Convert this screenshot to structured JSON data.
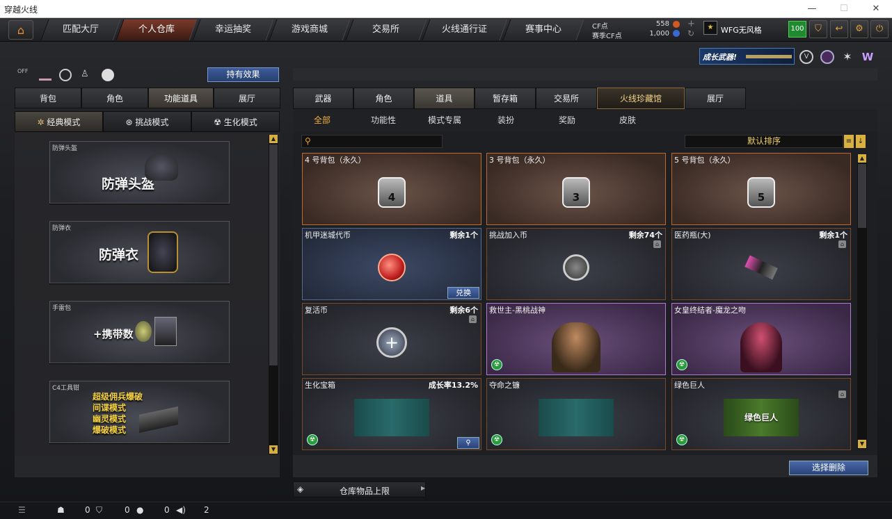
{
  "window": {
    "title": "穿越火线",
    "min": "—",
    "max": "☐",
    "close": "✕"
  },
  "topnav": {
    "tabs": [
      "匹配大厅",
      "个人仓库",
      "幸运抽奖",
      "游戏商城",
      "交易所",
      "火线通行证",
      "赛事中心"
    ],
    "cf_label": "CF点",
    "cf_value": "558",
    "scf_label": "赛季CF点",
    "scf_value": "1,000",
    "user": "WFG无风格",
    "level": "100"
  },
  "banner": {
    "text": "成长武器!"
  },
  "left": {
    "effects_btn": "持有效果",
    "tabs": [
      "背包",
      "角色",
      "功能道具",
      "展厅"
    ],
    "modes": [
      "经典模式",
      "挑战模式",
      "生化模式"
    ],
    "cards": [
      {
        "cap": "防弹头盔",
        "big": "防弹头盔"
      },
      {
        "cap": "防弹衣",
        "big": "防弹衣"
      },
      {
        "cap": "手雷包",
        "big": "+携带数"
      },
      {
        "cap": "C4工具钳",
        "lines": [
          "超级佣兵爆破",
          "间谍模式",
          "幽灵模式",
          "爆破模式"
        ]
      }
    ]
  },
  "right": {
    "tabs": [
      "武器",
      "角色",
      "道具",
      "暂存箱",
      "交易所",
      "火线珍藏馆",
      "展厅"
    ],
    "subtabs": [
      "全部",
      "功能性",
      "模式专属",
      "装扮",
      "奖励",
      "皮肤"
    ],
    "search_placeholder": "",
    "sort": "默认排序",
    "items": [
      {
        "name": "4 号背包（永久）",
        "bag": "4",
        "type": "bag"
      },
      {
        "name": "3 号背包（永久）",
        "bag": "3",
        "type": "bag"
      },
      {
        "name": "5 号背包（永久）",
        "bag": "5",
        "type": "bag"
      },
      {
        "name": "机甲迷城代币",
        "right": "剩余1个",
        "type": "blue",
        "btn": "兑换"
      },
      {
        "name": "挑战加入币",
        "right": "剩余74个",
        "type": "normal"
      },
      {
        "name": "医药瓶(大)",
        "right": "剩余1个",
        "type": "normal"
      },
      {
        "name": "复活币",
        "right": "剩余6个",
        "type": "normal"
      },
      {
        "name": "救世主-黑桃战神",
        "type": "purple"
      },
      {
        "name": "女皇终结者-魔龙之吻",
        "type": "purple"
      },
      {
        "name": "生化宝箱",
        "right": "成长率13.2%",
        "type": "normal"
      },
      {
        "name": "夺命之镰",
        "type": "normal"
      },
      {
        "name": "绿色巨人",
        "type": "normal",
        "label": "绿色巨人"
      }
    ],
    "delete_btn": "选择删除",
    "storage_btn": "仓库物品上限"
  },
  "status": {
    "c1": "0",
    "c2": "0",
    "c3": "0",
    "c4": "2"
  }
}
